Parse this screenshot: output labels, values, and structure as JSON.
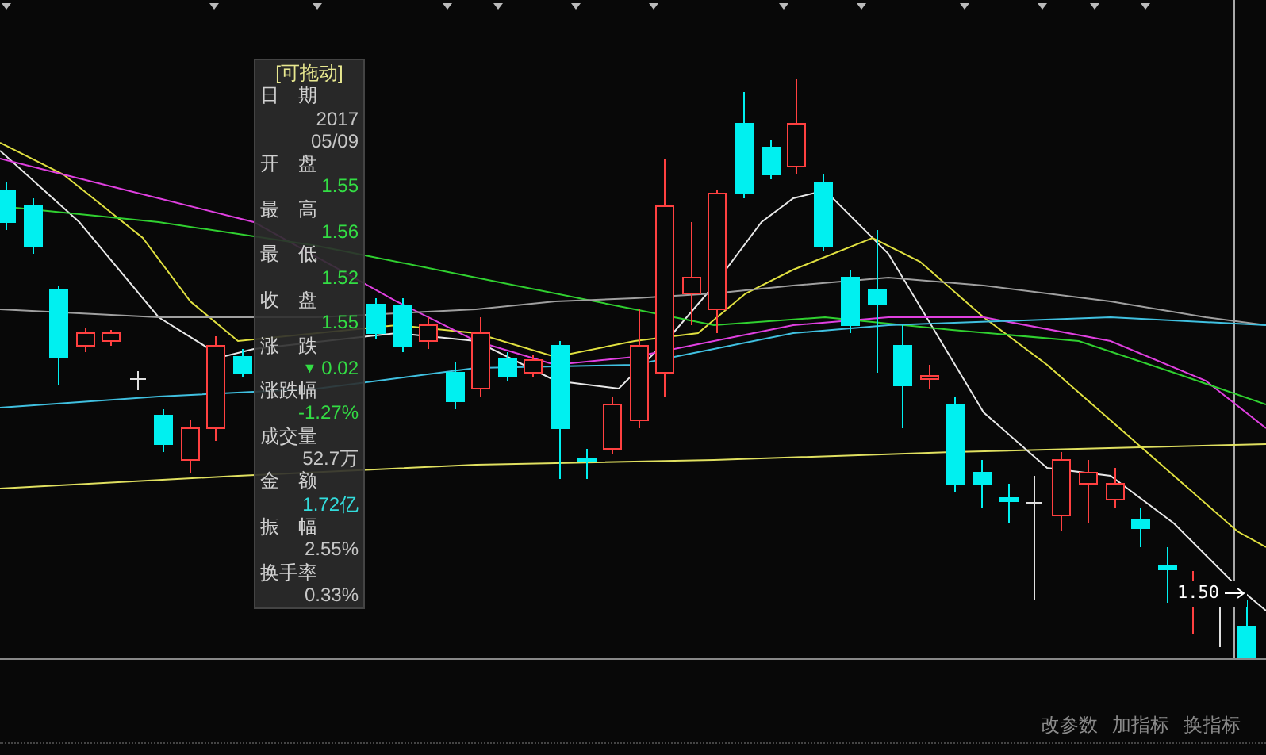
{
  "tooltip": {
    "title": "[可拖动]",
    "fields": [
      {
        "label": "日　期",
        "value": "2017",
        "value2": "05/09",
        "color": "#c8c8c8"
      },
      {
        "label": "开　盘",
        "value": "1.55",
        "color": "#33dd44"
      },
      {
        "label": "最　高",
        "value": "1.56",
        "color": "#33dd44"
      },
      {
        "label": "最　低",
        "value": "1.52",
        "color": "#33dd44"
      },
      {
        "label": "收　盘",
        "value": "1.55",
        "color": "#33dd44"
      },
      {
        "label": "涨　跌",
        "value": "0.02",
        "arrow": "▼",
        "color": "#33dd44"
      },
      {
        "label": "涨跌幅",
        "value": "-1.27%",
        "color": "#33dd44"
      },
      {
        "label": "成交量",
        "value": "52.7万",
        "color": "#c8c8c8"
      },
      {
        "label": "金　额",
        "value": "1.72亿",
        "color": "#33dddd"
      },
      {
        "label": "振　幅",
        "value": "2.55%",
        "color": "#c8c8c8"
      },
      {
        "label": "换手率",
        "value": "0.33%",
        "color": "#c8c8c8"
      }
    ]
  },
  "price_marker": "1.50",
  "buttons": [
    "改参数",
    "加指标",
    "换指标"
  ]
}
